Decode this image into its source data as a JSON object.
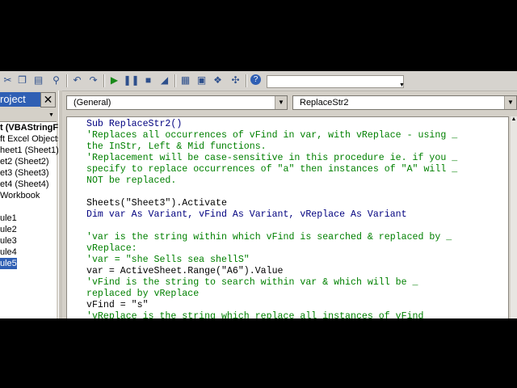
{
  "toolbar": {
    "icons": [
      "cut-icon",
      "copy-icon",
      "paste-icon",
      "find-icon",
      "undo-icon",
      "redo-icon",
      "run-icon",
      "break-icon",
      "reset-icon",
      "design-mode-icon",
      "project-explorer-icon",
      "properties-icon",
      "object-browser-icon",
      "toolbox-icon",
      "help-icon"
    ],
    "position_text": ""
  },
  "project": {
    "title": "roject",
    "close": "✕",
    "tree": [
      {
        "label": "t (VBAStringF",
        "bold": true
      },
      {
        "label": "ft Excel Objects"
      },
      {
        "label": "heet1 (Sheet1)"
      },
      {
        "label": "et2 (Sheet2)"
      },
      {
        "label": "et3 (Sheet3)"
      },
      {
        "label": "et4 (Sheet4)"
      },
      {
        "label": "Workbook"
      },
      {
        "label": ""
      },
      {
        "label": "ule1"
      },
      {
        "label": "ule2"
      },
      {
        "label": "ule3"
      },
      {
        "label": "ule4"
      },
      {
        "label": "ule5",
        "selected": true
      }
    ]
  },
  "codewindow": {
    "object_combo": "(General)",
    "proc_combo": "ReplaceStr2",
    "lines": [
      {
        "type": "code",
        "text": "Sub ReplaceStr2()"
      },
      {
        "type": "comment",
        "text": "'Replaces all occurrences of vFind in var, with vReplace - using _"
      },
      {
        "type": "comment",
        "text": "the InStr, Left & Mid functions."
      },
      {
        "type": "comment",
        "text": "'Replacement will be case-sensitive in this procedure ie. if you _"
      },
      {
        "type": "comment",
        "text": "specify to replace occurrences of \"a\" then instances of \"A\" will _"
      },
      {
        "type": "comment",
        "text": "NOT be replaced."
      },
      {
        "type": "code",
        "text": ""
      },
      {
        "type": "code",
        "text": "Sheets(\"Sheet3\").Activate"
      },
      {
        "type": "code",
        "text": "Dim var As Variant, vFind As Variant, vReplace As Variant"
      },
      {
        "type": "code",
        "text": ""
      },
      {
        "type": "comment",
        "text": "'var is the string within which vFind is searched & replaced by _"
      },
      {
        "type": "comment",
        "text": "vReplace:"
      },
      {
        "type": "comment",
        "text": "'var = \"she Sells sea shellS\""
      },
      {
        "type": "code",
        "text": "var = ActiveSheet.Range(\"A6\").Value"
      },
      {
        "type": "comment",
        "text": "'vFind is the string to search within var & which will be _"
      },
      {
        "type": "comment",
        "text": "replaced by vReplace"
      },
      {
        "type": "code",
        "text": "vFind = \"s\""
      },
      {
        "type": "comment",
        "text": "'vReplace is the string which replace all instances of vFind"
      }
    ]
  }
}
